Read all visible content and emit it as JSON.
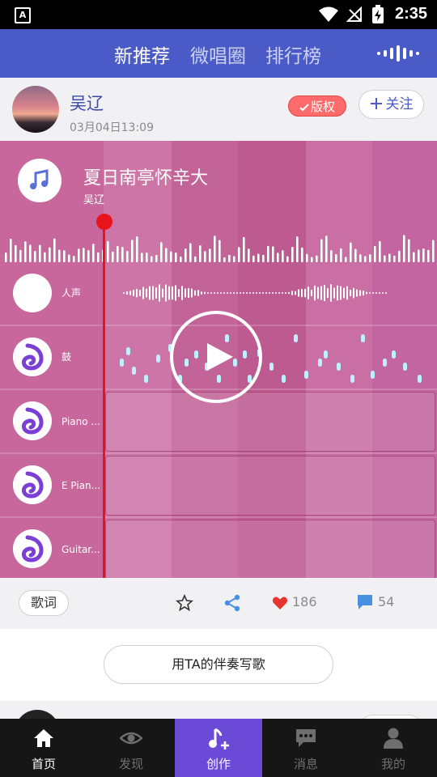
{
  "status_bar": {
    "time": "2:35"
  },
  "top_nav": {
    "tabs": [
      {
        "label": "新推荐"
      },
      {
        "label": "微唱圈"
      },
      {
        "label": "排行榜"
      }
    ]
  },
  "post": {
    "author": "吴辽",
    "date": "03月04日13:09",
    "copyright_label": "版权",
    "follow_label": "关注",
    "song": {
      "title": "夏日南亭怀辛大",
      "artist": "吴辽"
    },
    "tracks": [
      {
        "label": "人声"
      },
      {
        "label": "鼓"
      },
      {
        "label": "Piano ..."
      },
      {
        "label": "E Pian..."
      },
      {
        "label": "Guitar..."
      }
    ],
    "actions": {
      "lyrics_label": "歌词",
      "likes": "186",
      "comments": "54"
    },
    "compose_label": "用TA的伴奏写歌"
  },
  "bottom_nav": {
    "items": [
      {
        "label": "首页",
        "icon": "home-icon"
      },
      {
        "label": "发现",
        "icon": "eye-icon"
      },
      {
        "label": "创作",
        "icon": "music-note-plus-icon"
      },
      {
        "label": "消息",
        "icon": "chat-icon"
      },
      {
        "label": "我的",
        "icon": "person-icon"
      }
    ]
  },
  "colors": {
    "nav_blue": "#4a5bc7",
    "card_pink": "#c7679b",
    "playhead_red": "#e8141c",
    "active_tab_purple": "#6a4ad6"
  }
}
